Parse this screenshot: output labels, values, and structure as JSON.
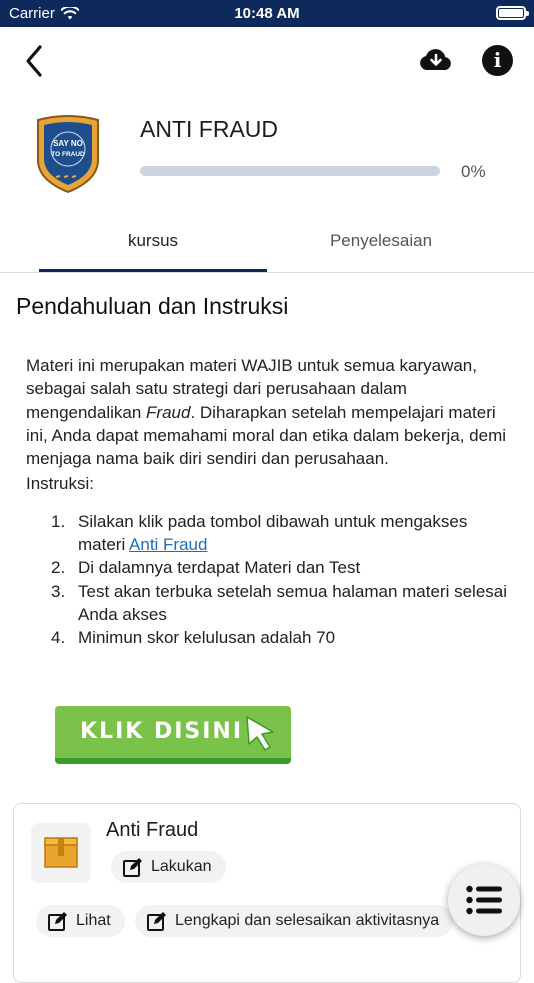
{
  "status_bar": {
    "carrier": "Carrier",
    "time": "10:48 AM"
  },
  "header": {
    "back_icon": "chevron-left-icon",
    "download_icon": "cloud-download-icon",
    "info_icon": "info-icon"
  },
  "course": {
    "badge_lines": [
      "SAY NO",
      "TO FRAUD"
    ],
    "title": "ANTI FRAUD",
    "progress": 0,
    "progress_label": "0%"
  },
  "tabs": [
    {
      "label": "kursus",
      "active": true
    },
    {
      "label": "Penyelesaian",
      "active": false
    }
  ],
  "section": {
    "title": "Pendahuluan dan Instruksi",
    "intro_before": "Materi ini merupakan materi WAJIB untuk semua karyawan, sebagai salah satu strategi dari perusahaan dalam mengendalikan ",
    "intro_italic": "Fraud",
    "intro_after": ". Diharapkan setelah mempelajari materi ini, Anda dapat memahami moral dan etika dalam bekerja, demi menjaga nama baik diri sendiri dan perusahaan.",
    "instructions_label": "Instruksi:",
    "steps": [
      {
        "num": "1.",
        "text": "Silakan klik pada tombol dibawah untuk mengakses materi ",
        "link": "Anti Fraud"
      },
      {
        "num": "2.",
        "text": "Di dalamnya terdapat Materi dan Test"
      },
      {
        "num": "3.",
        "text": "Test akan terbuka setelah semua halaman materi selesai Anda akses"
      },
      {
        "num": "4.",
        "text": "Minimun skor kelulusan adalah 70"
      }
    ],
    "cta_label": "KLIK DISINI"
  },
  "activity": {
    "title": "Anti Fraud",
    "action_primary": "Lakukan",
    "action_view": "Lihat",
    "action_complete": "Lengkapi dan selesaikan aktivitasnya"
  },
  "colors": {
    "navy": "#0e2a5c",
    "green": "#7bc24a",
    "link": "#1a6fb8"
  }
}
